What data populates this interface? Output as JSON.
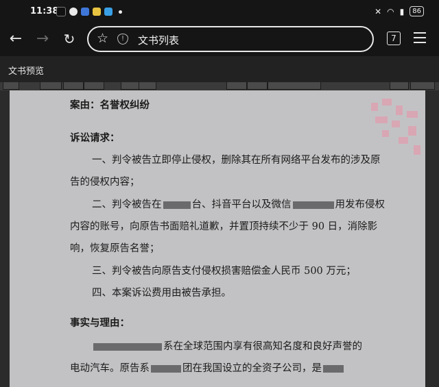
{
  "status_bar": {
    "time": "11:38",
    "battery": "86",
    "left_icons": [
      "tiktok-icon",
      "wechat-icon",
      "app-icon",
      "app-icon",
      "app-icon"
    ],
    "right_icons": [
      "mute-icon",
      "wifi-icon",
      "signal-icon"
    ]
  },
  "browser": {
    "url_text": "文书列表",
    "tab_count": "7",
    "icons": [
      "back-arrow-icon",
      "forward-arrow-icon",
      "reload-icon",
      "star-icon",
      "shield-icon",
      "menu-icon"
    ]
  },
  "preview": {
    "title": "文书预览"
  },
  "document": {
    "case_cause": "案由：名誉权纠纷",
    "claims_heading": "诉讼请求：",
    "claim1_line1": "一、判令被告立即停止侵权，删除其在所有网络平台发布的涉及原",
    "claim1_line2": "告的侵权内容；",
    "claim2_line1_a": "二、判令被告在",
    "claim2_line1_b": "台、抖音平台以及微信",
    "claim2_line1_c": "用发布侵权",
    "claim2_line2": "内容的账号，向原告书面赔礼道歉，并置顶持续不少于 90 日，消除影",
    "claim2_line3": "响，恢复原告名誉；",
    "claim3": "三、判令被告向原告支付侵权损害赔偿金人民币 500 万元；",
    "claim4": "四、本案诉讼费用由被告承担。",
    "facts_heading": "事实与理由：",
    "facts_line1": "系在全球范围内享有很高知名度和良好声誉的",
    "facts_line2_a": "电动汽车。原告系",
    "facts_line2_b": "团在我国设立的全资子公司，是"
  }
}
